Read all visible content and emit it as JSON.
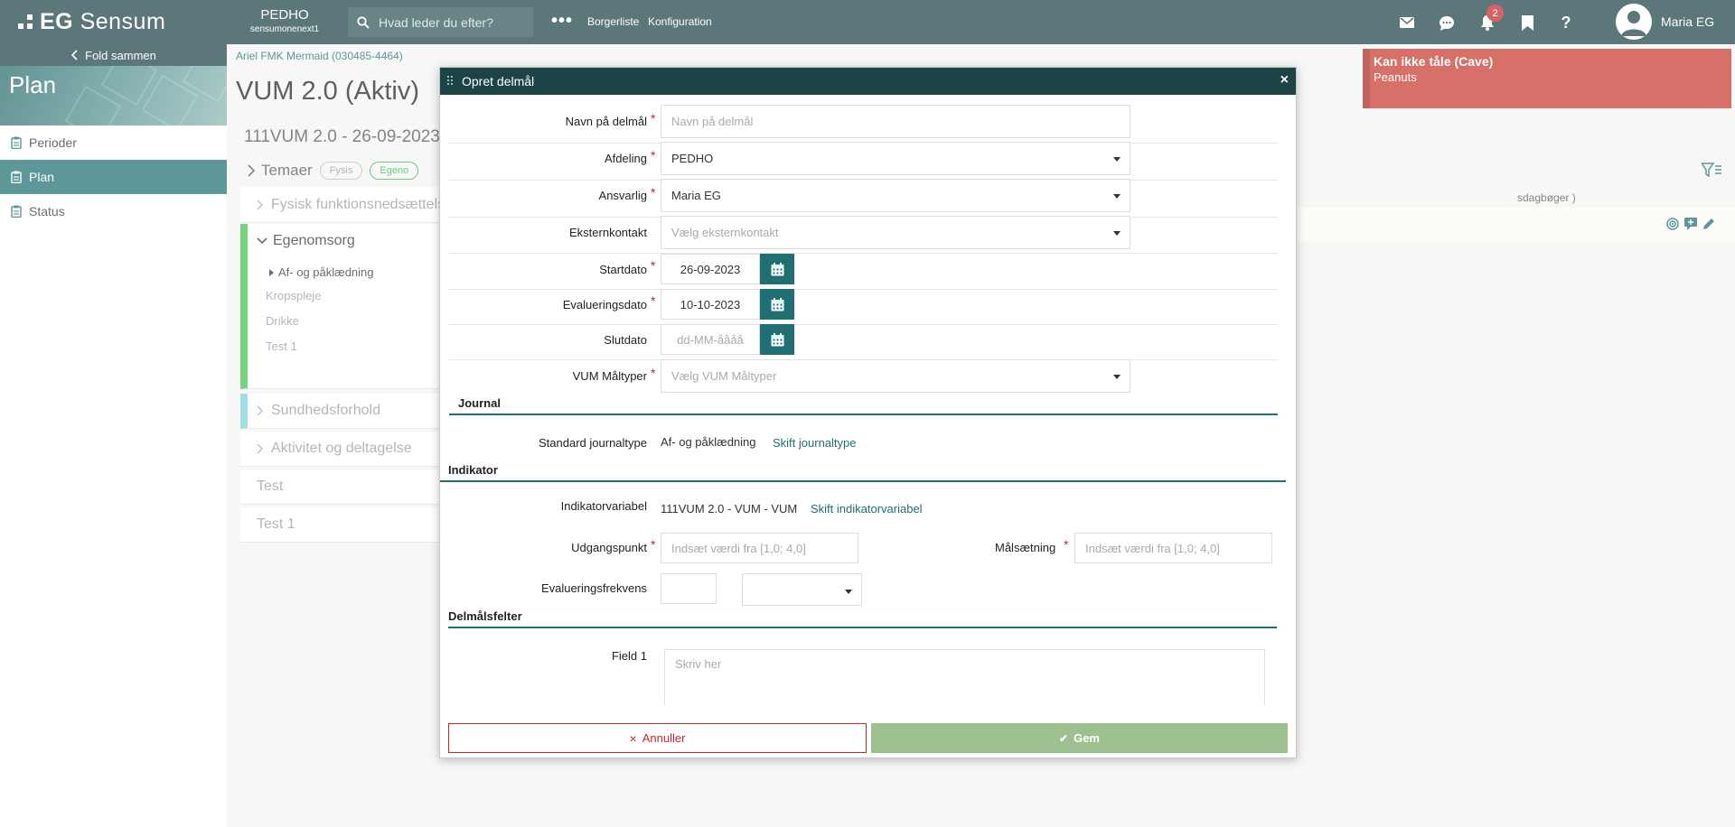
{
  "header": {
    "logo_eg": "EG",
    "logo_product": "Sensum",
    "org_name": "PEDHO",
    "org_sub": "sensumonenext1",
    "search_placeholder": "Hvad leder du efter?",
    "more": "•••",
    "nav": [
      "Borgerliste",
      "Konfiguration"
    ],
    "notification_count": "2",
    "user_name": "Maria EG",
    "icons": [
      "mail-icon",
      "chat-icon",
      "bell-icon",
      "bookmark-icon",
      "help-icon"
    ],
    "help_glyph": "?"
  },
  "sidebar": {
    "collapse_label": "Fold sammen",
    "title": "Plan",
    "items": [
      {
        "label": "Perioder",
        "active": false
      },
      {
        "label": "Plan",
        "active": true
      },
      {
        "label": "Status",
        "active": false
      }
    ]
  },
  "page": {
    "breadcrumb": "Ariel FMK Mermaid (030485-4464)",
    "title": "VUM 2.0 (Aktiv)",
    "plan_sub": "111VUM 2.0 - 26-09-2023",
    "temaer_label": "Temaer",
    "chips": [
      "Fysis",
      "Egeno"
    ],
    "cards": {
      "fysisk": "Fysisk funktionsnedsættelse",
      "egenomsorg": "Egenomsorg",
      "sub_items": [
        "Af- og påklædning",
        "Kropspleje",
        "Drikke",
        "Test 1"
      ],
      "sundhed": "Sundhedsforhold",
      "aktivitet": "Aktivitet og deltagelse",
      "test": "Test",
      "test1": "Test 1"
    },
    "dagboger": "sdagbøger )"
  },
  "alert": {
    "title": "Kan ikke tåle (Cave)",
    "text": "Peanuts"
  },
  "modal": {
    "title": "Opret delmål",
    "close": "×",
    "fields": {
      "navn": {
        "label": "Navn på delmål",
        "placeholder": "Navn på delmål"
      },
      "afdeling": {
        "label": "Afdeling",
        "value": "PEDHO"
      },
      "ansvarlig": {
        "label": "Ansvarlig",
        "value": "Maria EG"
      },
      "eksternkontakt": {
        "label": "Eksternkontakt",
        "placeholder": "Vælg eksternkontakt"
      },
      "startdato": {
        "label": "Startdato",
        "value": "26-09-2023"
      },
      "evalueringsdato": {
        "label": "Evalueringsdato",
        "value": "10-10-2023"
      },
      "slutdato": {
        "label": "Slutdato",
        "placeholder": "dd-MM-åååå"
      },
      "maltyper": {
        "label": "VUM Måltyper",
        "placeholder": "Vælg VUM Måltyper"
      }
    },
    "journal": {
      "section": "Journal",
      "label": "Standard journaltype",
      "value": "Af- og påklædning",
      "link": "Skift journaltype"
    },
    "indikator": {
      "section": "Indikator",
      "label": "Indikatorvariabel",
      "value": "111VUM 2.0 - VUM - VUM",
      "link": "Skift indikatorvariabel",
      "udgang_label": "Udgangspunkt",
      "udgang_placeholder": "Indsæt værdi fra [1,0; 4,0]",
      "maal_label": "Målsætning",
      "maal_placeholder": "Indsæt værdi fra [1,0; 4,0]",
      "freq_label": "Evalueringsfrekvens"
    },
    "delmaal": {
      "section": "Delmålsfelter",
      "field1_label": "Field 1",
      "field1_placeholder": "Skriv her"
    },
    "footer": {
      "cancel_icon": "×",
      "cancel": "Annuller",
      "save_icon": "✔",
      "save": "Gem"
    }
  },
  "colors": {
    "topbar": "#1c4346",
    "accent": "#1f6f73",
    "danger": "#c8262e",
    "save": "#9dc08f",
    "green": "#3fc24a"
  }
}
